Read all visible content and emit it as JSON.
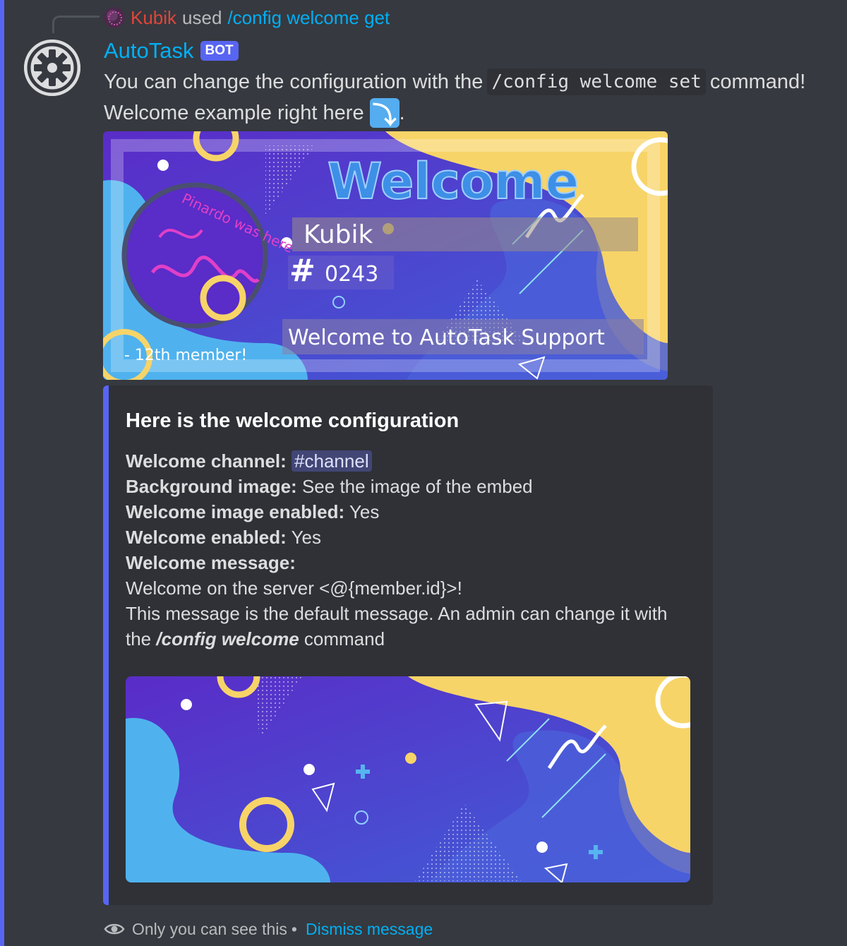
{
  "reply": {
    "user": "Kubik",
    "used": "used",
    "command": "/config welcome get"
  },
  "message": {
    "author": "AutoTask",
    "bot_tag": "BOT",
    "line1_before": "You can change the configuration with the",
    "line1_code": "/config welcome set",
    "line1_after": "command!",
    "line2_text": "Welcome example right here",
    "line2_emoji": "⤵",
    "line2_end": "."
  },
  "welcome_card": {
    "title": "Welcome",
    "username": "Kubik",
    "discriminator": "0243",
    "hash_glyph": "#",
    "server_text": "Welcome to AutoTask Support",
    "member_count": "- 12th member!",
    "avatar_scribble": "Pinardo was here"
  },
  "embed": {
    "title": "Here is the welcome configuration",
    "fields": {
      "channel_label": "Welcome channel:",
      "channel_hash": "#",
      "channel_value": "channel",
      "background_label": "Background image:",
      "background_value": "See the image of the embed",
      "image_enabled_label": "Welcome image enabled:",
      "image_enabled_value": "Yes",
      "enabled_label": "Welcome enabled:",
      "enabled_value": "Yes",
      "message_label": "Welcome message:",
      "message_value": "Welcome on the server <@{member.id}>!",
      "note_line1": "This message is the default message. An admin can change it with",
      "note_the": "the",
      "note_cmd": "/config welcome",
      "note_end": "command"
    }
  },
  "footer": {
    "eye_icon": "eye-icon",
    "text": "Only you can see this",
    "separator": "•",
    "dismiss": "Dismiss message"
  },
  "colors": {
    "background": "#36393f",
    "embed_bg": "#2f3136",
    "accent": "#5865f2",
    "link": "#00aff4",
    "reply_user": "#e0453a"
  }
}
